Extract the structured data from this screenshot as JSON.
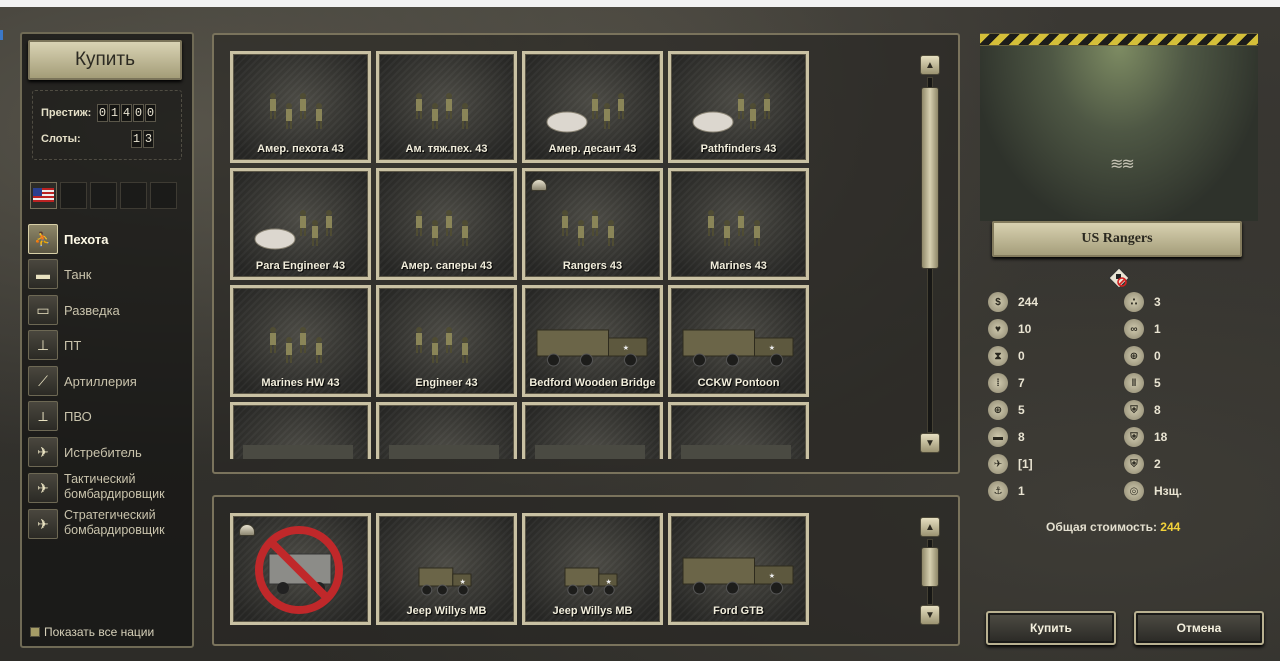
{
  "header": {
    "buy_label": "Купить",
    "eagle_icon": "eagle-emblem-icon"
  },
  "resources": {
    "prestige_label": "Престиж:",
    "prestige_digits": [
      "0",
      "1",
      "4",
      "0",
      "0"
    ],
    "slots_label": "Слоты:",
    "slots_digits": [
      "1",
      "3"
    ]
  },
  "nations": {
    "active_flag": "us-flag-icon"
  },
  "categories": [
    {
      "label": "Пехота",
      "icon": "infantry-icon",
      "glyph": "⛹",
      "active": true
    },
    {
      "label": "Танк",
      "icon": "tank-icon",
      "glyph": "▬"
    },
    {
      "label": "Разведка",
      "icon": "recon-car-icon",
      "glyph": "▭"
    },
    {
      "label": "ПТ",
      "icon": "anti-tank-gun-icon",
      "glyph": "⊥"
    },
    {
      "label": "Артиллерия",
      "icon": "artillery-icon",
      "glyph": "⟋"
    },
    {
      "label": "ПВО",
      "icon": "anti-air-icon",
      "glyph": "⟂"
    },
    {
      "label": "Истребитель",
      "icon": "fighter-plane-icon",
      "glyph": "✈"
    },
    {
      "label": "Тактический бомбардировщик",
      "line1": "Тактический",
      "line2": "бомбардировщик",
      "icon": "tactical-bomber-icon",
      "glyph": "✈"
    },
    {
      "label": "Стратегический бомбардировщик",
      "line1": "Стратегический",
      "line2": "бомбардировщик",
      "icon": "strategic-bomber-icon",
      "glyph": "✈"
    }
  ],
  "show_all_nations": "Показать все нации",
  "unit_grid": [
    {
      "name": "Амер. пехота 43",
      "kind": "infantry"
    },
    {
      "name": "Ам. тяж.пех. 43",
      "kind": "infantry"
    },
    {
      "name": "Амер. десант 43",
      "kind": "para"
    },
    {
      "name": "Pathfinders 43",
      "kind": "para"
    },
    {
      "name": "Para Engineer 43",
      "kind": "para"
    },
    {
      "name": "Амер. саперы 43",
      "kind": "infantry"
    },
    {
      "name": "Rangers 43",
      "kind": "infantry",
      "helmet": true
    },
    {
      "name": "Marines 43",
      "kind": "infantry"
    },
    {
      "name": "Marines HW 43",
      "kind": "infantry"
    },
    {
      "name": "Engineer 43",
      "kind": "infantry"
    },
    {
      "name": "Bedford Wooden Bridge",
      "kind": "truck"
    },
    {
      "name": "CCKW Pontoon",
      "kind": "truck"
    },
    {
      "name": "",
      "kind": "partial"
    },
    {
      "name": "",
      "kind": "partial"
    },
    {
      "name": "",
      "kind": "partial"
    },
    {
      "name": "",
      "kind": "partial"
    }
  ],
  "transport_grid": [
    {
      "name": "",
      "kind": "no-transport"
    },
    {
      "name": "Jeep Willys MB",
      "kind": "jeep"
    },
    {
      "name": "Jeep Willys MB",
      "kind": "jeep"
    },
    {
      "name": "Ford GTB",
      "kind": "truck"
    }
  ],
  "selected_unit": {
    "name": "US Rangers",
    "stats_left": [
      {
        "icon": "coins-icon",
        "glyph": "$",
        "value": "244"
      },
      {
        "icon": "heart-icon",
        "glyph": "♥",
        "value": "10"
      },
      {
        "icon": "fuel-icon",
        "glyph": "⧗",
        "value": "0"
      },
      {
        "icon": "ammo-icon",
        "glyph": "⁞",
        "value": "7"
      },
      {
        "icon": "soft-attack-icon",
        "glyph": "⊕",
        "value": "5"
      },
      {
        "icon": "hard-attack-icon",
        "glyph": "▬",
        "value": "8"
      },
      {
        "icon": "air-attack-icon",
        "glyph": "✈",
        "value": "[1]"
      },
      {
        "icon": "naval-attack-icon",
        "glyph": "⚓",
        "value": "1"
      }
    ],
    "stats_right": [
      {
        "icon": "movement-icon",
        "glyph": "∴",
        "value": "3"
      },
      {
        "icon": "spotting-icon",
        "glyph": "∞",
        "value": "1"
      },
      {
        "icon": "range-icon",
        "glyph": "⊕",
        "value": "0"
      },
      {
        "icon": "initiative-icon",
        "glyph": "‖",
        "value": "5"
      },
      {
        "icon": "ground-defense-icon",
        "glyph": "⛨",
        "value": "8"
      },
      {
        "icon": "air-defense-icon",
        "glyph": "⛨",
        "value": "18"
      },
      {
        "icon": "close-defense-icon",
        "glyph": "⛨",
        "value": "2"
      },
      {
        "icon": "target-type-icon",
        "glyph": "◎",
        "value": "Нзщ."
      }
    ],
    "total_label": "Общая стоимость:",
    "total_value": "244"
  },
  "actions": {
    "buy": "Купить",
    "cancel": "Отмена"
  },
  "colors": {
    "frame": "#c9c1a3",
    "accent_yellow": "#f2d23a",
    "hazard_yellow": "#d4bf39"
  }
}
